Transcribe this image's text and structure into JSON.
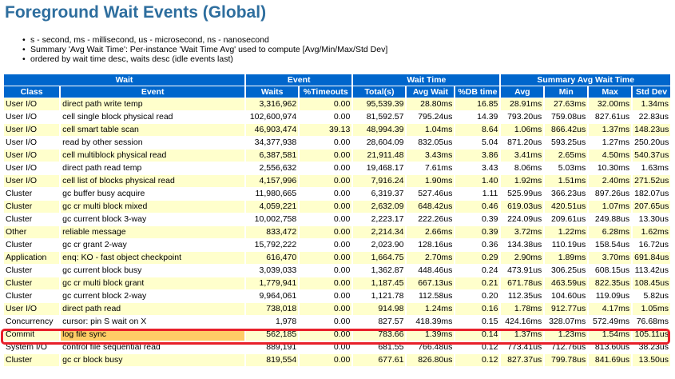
{
  "title": "Foreground Wait Events (Global)",
  "notes": [
    "s - second, ms - millisecond, us - microsecond, ns - nanosecond",
    "Summary 'Avg Wait Time': Per-instance 'Wait Time Avg' used to compute [Avg/Min/Max/Std Dev]",
    "ordered by wait time desc, waits desc (idle events last)"
  ],
  "group_headers": [
    "Wait",
    "Event",
    "Wait Time",
    "Summary Avg Wait Time"
  ],
  "columns": [
    "Class",
    "Event",
    "Waits",
    "%Timeouts",
    "Total(s)",
    "Avg Wait",
    "%DB time",
    "Avg",
    "Min",
    "Max",
    "Std Dev"
  ],
  "rows": [
    [
      "User I/O",
      "direct path write temp",
      "3,316,962",
      "0.00",
      "95,539.39",
      "28.80ms",
      "16.85",
      "28.91ms",
      "27.63ms",
      "32.00ms",
      "1.34ms"
    ],
    [
      "User I/O",
      "cell single block physical read",
      "102,600,974",
      "0.00",
      "81,592.57",
      "795.24us",
      "14.39",
      "793.20us",
      "759.08us",
      "827.61us",
      "22.83us"
    ],
    [
      "User I/O",
      "cell smart table scan",
      "46,903,474",
      "39.13",
      "48,994.39",
      "1.04ms",
      "8.64",
      "1.06ms",
      "866.42us",
      "1.37ms",
      "148.23us"
    ],
    [
      "User I/O",
      "read by other session",
      "34,377,938",
      "0.00",
      "28,604.09",
      "832.05us",
      "5.04",
      "871.20us",
      "593.25us",
      "1.27ms",
      "250.20us"
    ],
    [
      "User I/O",
      "cell multiblock physical read",
      "6,387,581",
      "0.00",
      "21,911.48",
      "3.43ms",
      "3.86",
      "3.41ms",
      "2.65ms",
      "4.50ms",
      "540.37us"
    ],
    [
      "User I/O",
      "direct path read temp",
      "2,556,632",
      "0.00",
      "19,468.17",
      "7.61ms",
      "3.43",
      "8.06ms",
      "5.03ms",
      "10.30ms",
      "1.63ms"
    ],
    [
      "User I/O",
      "cell list of blocks physical read",
      "4,157,996",
      "0.00",
      "7,916.24",
      "1.90ms",
      "1.40",
      "1.92ms",
      "1.51ms",
      "2.40ms",
      "271.52us"
    ],
    [
      "Cluster",
      "gc buffer busy acquire",
      "11,980,665",
      "0.00",
      "6,319.37",
      "527.46us",
      "1.11",
      "525.99us",
      "366.23us",
      "897.26us",
      "182.07us"
    ],
    [
      "Cluster",
      "gc cr multi block mixed",
      "4,059,221",
      "0.00",
      "2,632.09",
      "648.42us",
      "0.46",
      "619.03us",
      "420.51us",
      "1.07ms",
      "207.65us"
    ],
    [
      "Cluster",
      "gc current block 3-way",
      "10,002,758",
      "0.00",
      "2,223.17",
      "222.26us",
      "0.39",
      "224.09us",
      "209.61us",
      "249.88us",
      "13.30us"
    ],
    [
      "Other",
      "reliable message",
      "833,472",
      "0.00",
      "2,214.34",
      "2.66ms",
      "0.39",
      "3.72ms",
      "1.22ms",
      "6.28ms",
      "1.62ms"
    ],
    [
      "Cluster",
      "gc cr grant 2-way",
      "15,792,222",
      "0.00",
      "2,023.90",
      "128.16us",
      "0.36",
      "134.38us",
      "110.19us",
      "158.54us",
      "16.72us"
    ],
    [
      "Application",
      "enq: KO - fast object checkpoint",
      "616,470",
      "0.00",
      "1,664.75",
      "2.70ms",
      "0.29",
      "2.90ms",
      "1.89ms",
      "3.70ms",
      "691.84us"
    ],
    [
      "Cluster",
      "gc current block busy",
      "3,039,033",
      "0.00",
      "1,362.87",
      "448.46us",
      "0.24",
      "473.91us",
      "306.25us",
      "608.15us",
      "113.42us"
    ],
    [
      "Cluster",
      "gc cr multi block grant",
      "1,779,941",
      "0.00",
      "1,187.45",
      "667.13us",
      "0.21",
      "671.78us",
      "463.59us",
      "822.35us",
      "108.45us"
    ],
    [
      "Cluster",
      "gc current block 2-way",
      "9,964,061",
      "0.00",
      "1,121.78",
      "112.58us",
      "0.20",
      "112.35us",
      "104.60us",
      "119.09us",
      "5.82us"
    ],
    [
      "User I/O",
      "direct path read",
      "738,018",
      "0.00",
      "914.98",
      "1.24ms",
      "0.16",
      "1.78ms",
      "912.77us",
      "4.17ms",
      "1.05ms"
    ],
    [
      "Concurrency",
      "cursor: pin S wait on X",
      "1,978",
      "0.00",
      "827.57",
      "418.39ms",
      "0.15",
      "424.16ms",
      "328.07ms",
      "572.49ms",
      "76.68ms"
    ],
    [
      "Commit",
      "log file sync",
      "562,185",
      "0.00",
      "783.66",
      "1.39ms",
      "0.14",
      "1.37ms",
      "1.23ms",
      "1.54ms",
      "105.11us"
    ],
    [
      "System I/O",
      "control file sequential read",
      "889,191",
      "0.00",
      "681.55",
      "766.48us",
      "0.12",
      "773.41us",
      "712.76us",
      "813.60us",
      "38.23us"
    ],
    [
      "Cluster",
      "gc cr block busy",
      "819,554",
      "0.00",
      "677.61",
      "826.80us",
      "0.12",
      "827.37us",
      "799.78us",
      "841.69us",
      "13.50us"
    ]
  ],
  "highlight_row": 18,
  "colors": {
    "title": "#2e6e9e",
    "header_bg": "#0066cc",
    "row_odd": "#ffffcc",
    "row_even": "#ffffff",
    "highlight_cell": "#ffcc66",
    "highlight_box": "#e8202a"
  }
}
